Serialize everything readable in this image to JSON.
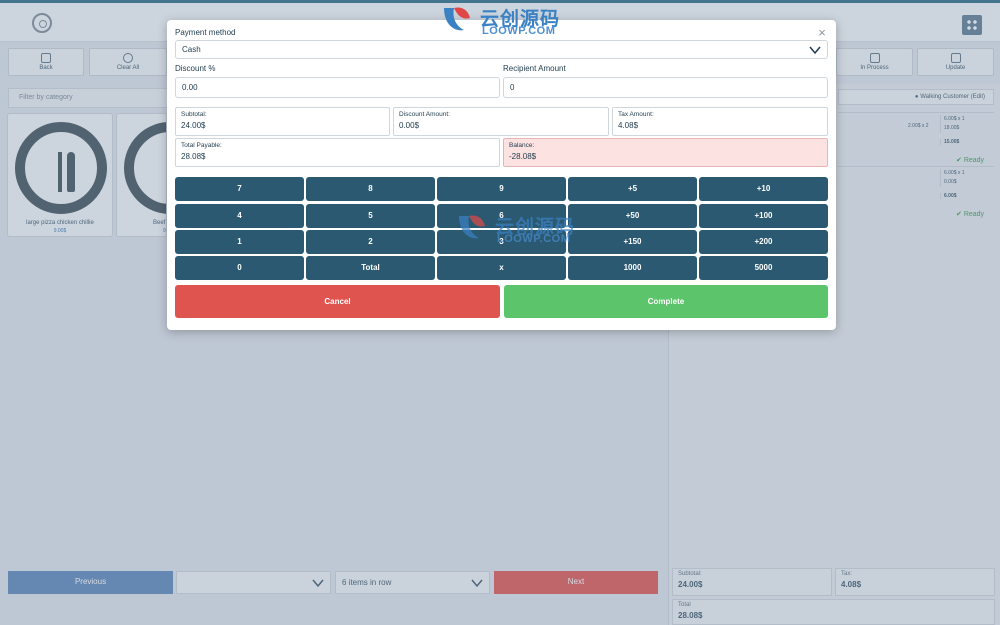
{
  "background": {
    "toolbar": {
      "back": "Back",
      "clear_all": "Clear All",
      "in_process": "In Process",
      "update": "Update"
    },
    "filter_placeholder": "Filter by category",
    "products": [
      {
        "name": "large pizza chicken chillie",
        "price": "9.00$"
      },
      {
        "name": "Beef",
        "price": "9."
      }
    ],
    "customer_label": "Walking Customer (Edit)",
    "line_items": [
      {
        "qty": "2.00$ x 2",
        "unit": "6.00$ x 1",
        "sub": "18.00$",
        "total": "15.00$",
        "status": "Ready"
      },
      {
        "qty": "",
        "unit": "6.00$ x 1",
        "sub": "0.00$",
        "total": "6.00$",
        "status": "Ready"
      }
    ],
    "pagination": {
      "previous": "Previous",
      "per_row": "6 items in row",
      "next": "Next"
    },
    "totals": {
      "subtotal_label": "Subtotal:",
      "subtotal_value": "24.00$",
      "tax_label": "Tax:",
      "tax_value": "4.08$",
      "total_label": "Total",
      "total_value": "28.08$"
    }
  },
  "modal": {
    "payment_method_label": "Payment method",
    "payment_method_value": "Cash",
    "discount_label": "Discount %",
    "discount_value": "0.00",
    "recipient_label": "Recipient Amount",
    "recipient_value": "0",
    "subtotal_label": "Subtotal:",
    "subtotal_value": "24.00$",
    "discount_amount_label": "Discount Amount:",
    "discount_amount_value": "0.00$",
    "tax_amount_label": "Tax Amount:",
    "tax_amount_value": "4.08$",
    "total_payable_label": "Total Payable:",
    "total_payable_value": "28.08$",
    "balance_label": "Balance:",
    "balance_value": "-28.08$",
    "keypad": [
      [
        "7",
        "8",
        "9",
        "+5",
        "+10"
      ],
      [
        "4",
        "5",
        "6",
        "+50",
        "+100"
      ],
      [
        "1",
        "2",
        "3",
        "+150",
        "+200"
      ],
      [
        "0",
        "Total",
        "x",
        "1000",
        "5000"
      ]
    ],
    "cancel_label": "Cancel",
    "complete_label": "Complete",
    "close_symbol": "×"
  },
  "watermark": {
    "cn": "云创源码",
    "en": "LOOWP.COM"
  },
  "colors": {
    "key_bg": "#2b5971",
    "cancel": "#e05450",
    "complete": "#5cc46a",
    "balance_bg": "#fde2e2"
  }
}
